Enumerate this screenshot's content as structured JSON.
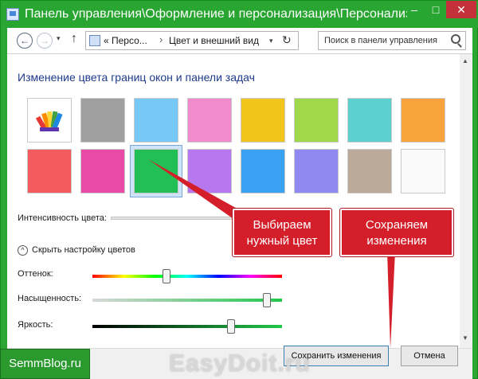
{
  "window": {
    "title": "Панель управления\\Оформление и персонализация\\Персонализаци",
    "min_glyph": "–",
    "max_glyph": "□",
    "close_glyph": "✕"
  },
  "address": {
    "back_glyph": "←",
    "forward_glyph": "→",
    "dropdown_glyph": "▾",
    "up_glyph": "↑",
    "path_prefix": "« Персо...",
    "path_separator": "›",
    "path_current": "Цвет и внешний вид",
    "refresh_glyph": "↻",
    "search_placeholder": "Поиск в панели управления"
  },
  "main": {
    "heading": "Изменение цвета границ окон и панели задач",
    "swatches_row1": [
      {
        "color": "#ffffff",
        "name": "custom-palette"
      },
      {
        "color": "#a0a0a0",
        "name": "gray"
      },
      {
        "color": "#77c8f7",
        "name": "light-blue"
      },
      {
        "color": "#f08ccd",
        "name": "pink"
      },
      {
        "color": "#f2c51d",
        "name": "yellow"
      },
      {
        "color": "#9fd94b",
        "name": "light-green"
      },
      {
        "color": "#5bd0cf",
        "name": "teal"
      },
      {
        "color": "#f9a33c",
        "name": "orange"
      }
    ],
    "swatches_row2": [
      {
        "color": "#f45b5e",
        "name": "red"
      },
      {
        "color": "#e94aa6",
        "name": "magenta"
      },
      {
        "color": "#21bf56",
        "name": "green"
      },
      {
        "color": "#b778ef",
        "name": "purple"
      },
      {
        "color": "#3aa2f2",
        "name": "blue"
      },
      {
        "color": "#8f89f1",
        "name": "lavender"
      },
      {
        "color": "#bba99a",
        "name": "taupe"
      },
      {
        "color": "#fafafa",
        "name": "white"
      }
    ],
    "selected_swatch": "green",
    "intensity_label": "Интенсивность цвета:",
    "hide_toggle_label": "Скрыть настройку цветов",
    "chevron_glyph": "^",
    "sliders": [
      {
        "label": "Оттенок:",
        "value_fraction": 0.39
      },
      {
        "label": "Насыщенность:",
        "value_fraction": 0.92
      },
      {
        "label": "Яркость:",
        "value_fraction": 0.73
      }
    ],
    "scroll_up_glyph": "▲",
    "scroll_down_glyph": "▼"
  },
  "footer": {
    "save_label": "Сохранить изменения",
    "cancel_label": "Отмена"
  },
  "annotations": {
    "pick_line1": "Выбираем",
    "pick_line2": "нужный цвет",
    "save_line1": "Сохраняем",
    "save_line2": "изменения",
    "accent_color": "#d41f2b"
  },
  "watermarks": {
    "left": "SemmBlog.ru",
    "center": "EasyDoit.ru"
  }
}
